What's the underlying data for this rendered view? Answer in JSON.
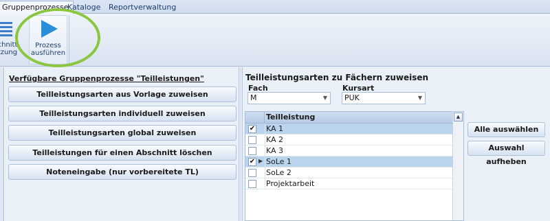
{
  "ribbon_tabs": [
    "Gruppenprozesse",
    "Kataloge",
    "Reportverwaltung"
  ],
  "ribbon": {
    "btn_a_line1": "chnitt",
    "btn_a_line2": "tzung",
    "btn_b_line1": "Prozess",
    "btn_b_line2": "ausführen"
  },
  "left": {
    "title": "Verfügbare Gruppenprozesse \"Teilleistungen\"",
    "buttons": [
      "Teilleistungsarten aus Vorlage zuweisen",
      "Teilleistungsarten individuell zuweisen",
      "Teilleistungsarten global zuweisen",
      "Teilleistungen für einen Abschnitt löschen",
      "Noteneingabe (nur vorbereitete TL)"
    ]
  },
  "right": {
    "title": "Teilleistungsarten zu Fächern zuweisen",
    "fach_label": "Fach",
    "fach_value": "M",
    "kursart_label": "Kursart",
    "kursart_value": "PUK",
    "grid_header": "Teilleistung",
    "rows": [
      {
        "label": "KA 1",
        "checked": "✔",
        "selected": true
      },
      {
        "label": "KA 2",
        "checked": "",
        "selected": false
      },
      {
        "label": "KA 3",
        "checked": "",
        "selected": false
      },
      {
        "label": "SoLe 1",
        "checked": "✔",
        "selected": true
      },
      {
        "label": "SoLe 2",
        "checked": "",
        "selected": false
      },
      {
        "label": "Projektarbeit",
        "checked": "",
        "selected": false
      }
    ],
    "select_all": "Alle auswählen",
    "deselect": "Auswahl aufheben"
  },
  "colors": {
    "accent": "#2a8fdb",
    "highlight_ring": "#8cc63f",
    "selected_row": "#bad4ee"
  }
}
